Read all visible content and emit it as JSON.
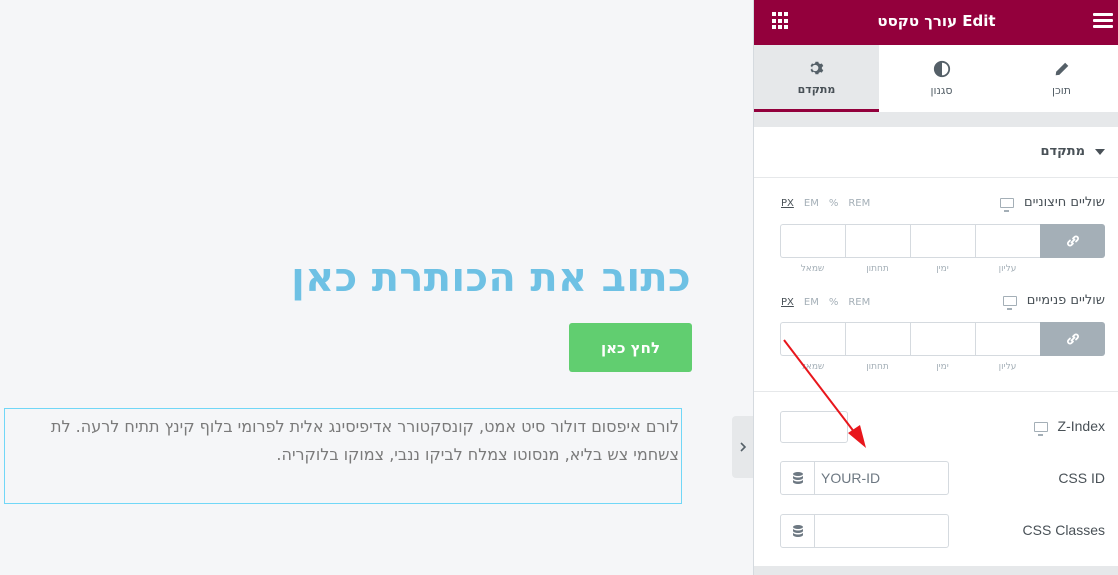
{
  "canvas": {
    "heading": "כתוב את הכותרת כאן",
    "button_label": "לחץ כאן",
    "paragraph": "לורם איפסום דולור סיט אמט, קונסקטורר אדיפיסינג אלית לפרומי בלוף קינץ תתיח לרעה. לת צשחמי צש בליא, מנסוטו צמלח לביקו ננבי, צמוקו בלוקריה.",
    "collapse_icon": "chevron-right-icon"
  },
  "panel": {
    "title": "עורך טקסט Edit",
    "tabs": [
      {
        "label": "תוכן",
        "icon": "pencil-icon",
        "active": false
      },
      {
        "label": "סגנון",
        "icon": "contrast-icon",
        "active": false
      },
      {
        "label": "מתקדם",
        "icon": "gear-icon",
        "active": true
      }
    ],
    "section_title": "מתקדם",
    "margin": {
      "label": "שוליים חיצוניים",
      "units": [
        "PX",
        "EM",
        "%",
        "REM"
      ],
      "active_unit": "PX",
      "sides": [
        "עליון",
        "ימין",
        "תחתון",
        "שמאל"
      ]
    },
    "padding": {
      "label": "שוליים פנימיים",
      "units": [
        "PX",
        "EM",
        "%",
        "REM"
      ],
      "active_unit": "PX",
      "sides": [
        "עליון",
        "ימין",
        "תחתון",
        "שמאל"
      ]
    },
    "zindex_label": "Z-Index",
    "css_id_label": "CSS ID",
    "css_id_value": "YOUR-ID",
    "css_classes_label": "CSS Classes",
    "colors": {
      "brand": "#93003c",
      "heading": "#6ec1e4",
      "button": "#61ce70",
      "arrow": "#e8161c"
    }
  }
}
